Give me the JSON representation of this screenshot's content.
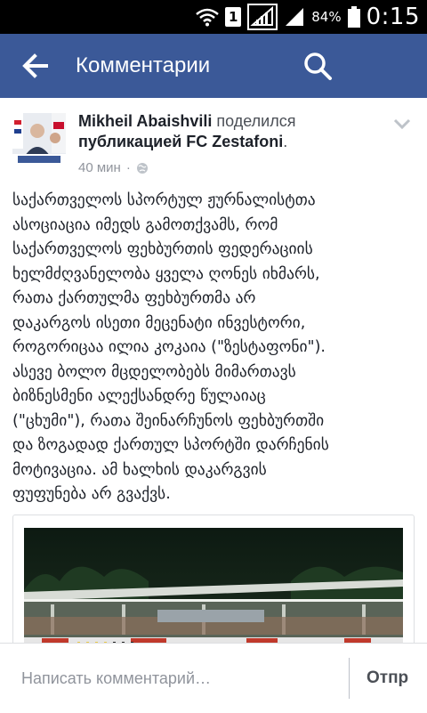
{
  "status_bar": {
    "sim_slot": "1",
    "battery": "84%",
    "time": "0:15",
    "icons": [
      "wifi-icon",
      "sim-icon",
      "signal-icon",
      "signal-icon",
      "battery-icon"
    ]
  },
  "app_bar": {
    "title": "Комментарии",
    "back_icon": "arrow-left-icon",
    "search_icon": "search-icon",
    "color": "#3b5998"
  },
  "post": {
    "author": "Mikheil Abaishvili",
    "action": "поделился",
    "object": "публикацией FC Zestafoni",
    "object_suffix": ".",
    "time": "40 мин",
    "separator": "·",
    "privacy_icon": "globe-icon",
    "body": "საქართველოს სპორტულ ჟურნალისტთა\nასოციაცია იმედს გამოთქვამს, რომ\nსაქართველოს ფეხბურთის ფედერაციის\nხელმძღვანელობა ყველა ღონეს იხმარს,\nრათა ქართულმა ფეხბურთმა არ\nდაკარგოს ისეთი მეცენატი ინვესტორი,\nროგორიცაა ილია კოკაია (\"ზესტაფონი\").\nასევე ბოლო მცდელობებს მიმართავს\nბიზნესმენი ალექსანდრე წულაიაც\n(\"ცხუმი\"), რათა შეინარჩუნოს ფეხბურთში\nდა ზოგადად ქართულ სპორტში დარჩენის\nმოტივაცია. ამ ხალხის დაკარგვის\nფუფუნება არ გვაქვს."
  },
  "composer": {
    "placeholder": "Написать комментарий…",
    "send_label": "Отпр"
  }
}
